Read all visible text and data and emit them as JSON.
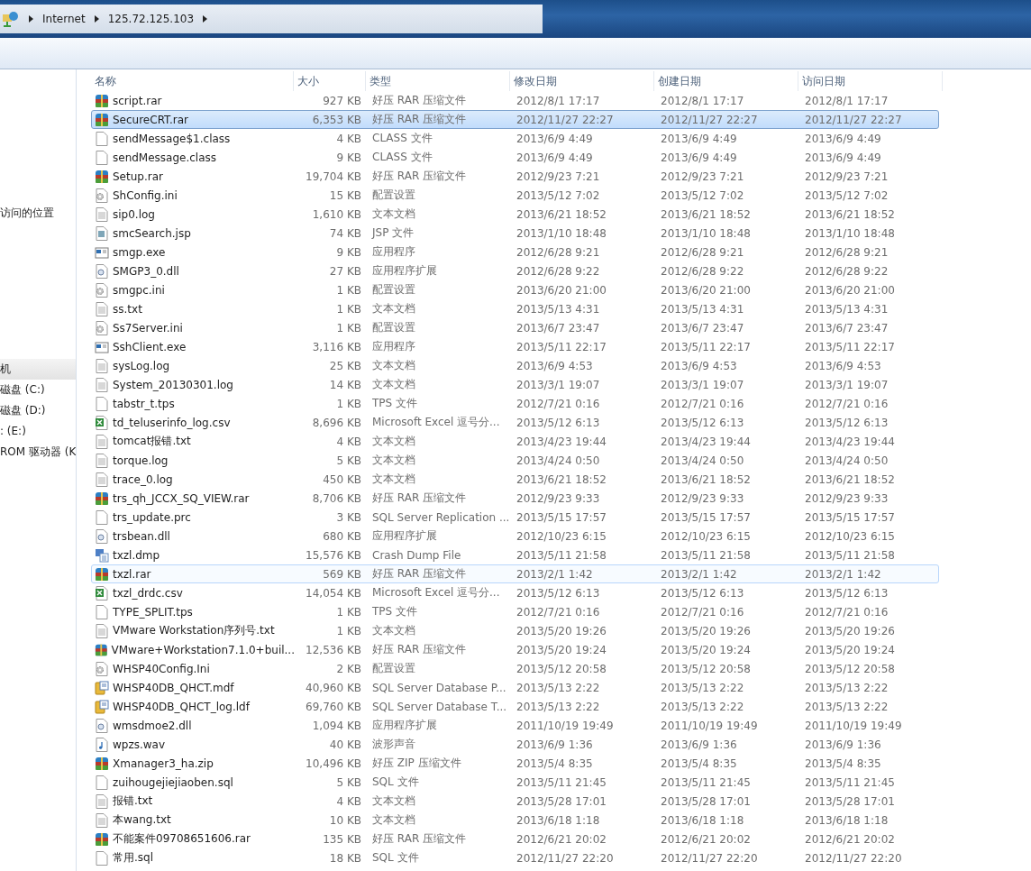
{
  "address_bar": {
    "crumbs": [
      "Internet",
      "125.72.125.103"
    ]
  },
  "sidebar": {
    "items": [
      {
        "label": "访问的位置",
        "selected": false
      },
      {
        "label": "机",
        "selected": true
      },
      {
        "label": "磁盘 (C:)",
        "selected": false
      },
      {
        "label": "磁盘 (D:)",
        "selected": false
      },
      {
        "label": ": (E:)",
        "selected": false
      },
      {
        "label": "ROM 驱动器 (K",
        "selected": false
      }
    ]
  },
  "table": {
    "columns": [
      "名称",
      "大小",
      "类型",
      "修改日期",
      "创建日期",
      "访问日期"
    ],
    "rows": [
      {
        "kind": "rar",
        "name": "script.rar",
        "size": "927 KB",
        "type": "好压 RAR 压缩文件",
        "modified": "2012/8/1 17:17",
        "created": "2012/8/1 17:17",
        "accessed": "2012/8/1 17:17",
        "selected": false,
        "focused": false
      },
      {
        "kind": "rar",
        "name": "SecureCRT.rar",
        "size": "6,353 KB",
        "type": "好压 RAR 压缩文件",
        "modified": "2012/11/27 22:27",
        "created": "2012/11/27 22:27",
        "accessed": "2012/11/27 22:27",
        "selected": true,
        "focused": false
      },
      {
        "kind": "blank",
        "name": "sendMessage$1.class",
        "size": "4 KB",
        "type": "CLASS 文件",
        "modified": "2013/6/9 4:49",
        "created": "2013/6/9 4:49",
        "accessed": "2013/6/9 4:49",
        "selected": false,
        "focused": false
      },
      {
        "kind": "blank",
        "name": "sendMessage.class",
        "size": "9 KB",
        "type": "CLASS 文件",
        "modified": "2013/6/9 4:49",
        "created": "2013/6/9 4:49",
        "accessed": "2013/6/9 4:49",
        "selected": false,
        "focused": false
      },
      {
        "kind": "rar",
        "name": "Setup.rar",
        "size": "19,704 KB",
        "type": "好压 RAR 压缩文件",
        "modified": "2012/9/23 7:21",
        "created": "2012/9/23 7:21",
        "accessed": "2012/9/23 7:21",
        "selected": false,
        "focused": false
      },
      {
        "kind": "ini",
        "name": "ShConfig.ini",
        "size": "15 KB",
        "type": "配置设置",
        "modified": "2013/5/12 7:02",
        "created": "2013/5/12 7:02",
        "accessed": "2013/5/12 7:02",
        "selected": false,
        "focused": false
      },
      {
        "kind": "text",
        "name": "sip0.log",
        "size": "1,610 KB",
        "type": "文本文档",
        "modified": "2013/6/21 18:52",
        "created": "2013/6/21 18:52",
        "accessed": "2013/6/21 18:52",
        "selected": false,
        "focused": false
      },
      {
        "kind": "script",
        "name": "smcSearch.jsp",
        "size": "74 KB",
        "type": "JSP 文件",
        "modified": "2013/1/10 18:48",
        "created": "2013/1/10 18:48",
        "accessed": "2013/1/10 18:48",
        "selected": false,
        "focused": false
      },
      {
        "kind": "exe",
        "name": "smgp.exe",
        "size": "9 KB",
        "type": "应用程序",
        "modified": "2012/6/28 9:21",
        "created": "2012/6/28 9:21",
        "accessed": "2012/6/28 9:21",
        "selected": false,
        "focused": false
      },
      {
        "kind": "dll",
        "name": "SMGP3_0.dll",
        "size": "27 KB",
        "type": "应用程序扩展",
        "modified": "2012/6/28 9:22",
        "created": "2012/6/28 9:22",
        "accessed": "2012/6/28 9:22",
        "selected": false,
        "focused": false
      },
      {
        "kind": "ini",
        "name": "smgpc.ini",
        "size": "1 KB",
        "type": "配置设置",
        "modified": "2013/6/20 21:00",
        "created": "2013/6/20 21:00",
        "accessed": "2013/6/20 21:00",
        "selected": false,
        "focused": false
      },
      {
        "kind": "text",
        "name": "ss.txt",
        "size": "1 KB",
        "type": "文本文档",
        "modified": "2013/5/13 4:31",
        "created": "2013/5/13 4:31",
        "accessed": "2013/5/13 4:31",
        "selected": false,
        "focused": false
      },
      {
        "kind": "ini",
        "name": "Ss7Server.ini",
        "size": "1 KB",
        "type": "配置设置",
        "modified": "2013/6/7 23:47",
        "created": "2013/6/7 23:47",
        "accessed": "2013/6/7 23:47",
        "selected": false,
        "focused": false
      },
      {
        "kind": "exe",
        "name": "SshClient.exe",
        "size": "3,116 KB",
        "type": "应用程序",
        "modified": "2013/5/11 22:17",
        "created": "2013/5/11 22:17",
        "accessed": "2013/5/11 22:17",
        "selected": false,
        "focused": false
      },
      {
        "kind": "text",
        "name": "sysLog.log",
        "size": "25 KB",
        "type": "文本文档",
        "modified": "2013/6/9 4:53",
        "created": "2013/6/9 4:53",
        "accessed": "2013/6/9 4:53",
        "selected": false,
        "focused": false
      },
      {
        "kind": "text",
        "name": "System_20130301.log",
        "size": "14 KB",
        "type": "文本文档",
        "modified": "2013/3/1 19:07",
        "created": "2013/3/1 19:07",
        "accessed": "2013/3/1 19:07",
        "selected": false,
        "focused": false
      },
      {
        "kind": "blank",
        "name": "tabstr_t.tps",
        "size": "1 KB",
        "type": "TPS 文件",
        "modified": "2012/7/21 0:16",
        "created": "2012/7/21 0:16",
        "accessed": "2012/7/21 0:16",
        "selected": false,
        "focused": false
      },
      {
        "kind": "excel",
        "name": "td_teluserinfo_log.csv",
        "size": "8,696 KB",
        "type": "Microsoft Excel 逗号分...",
        "modified": "2013/5/12 6:13",
        "created": "2013/5/12 6:13",
        "accessed": "2013/5/12 6:13",
        "selected": false,
        "focused": false
      },
      {
        "kind": "text",
        "name": "tomcat报错.txt",
        "size": "4 KB",
        "type": "文本文档",
        "modified": "2013/4/23 19:44",
        "created": "2013/4/23 19:44",
        "accessed": "2013/4/23 19:44",
        "selected": false,
        "focused": false
      },
      {
        "kind": "text",
        "name": "torque.log",
        "size": "5 KB",
        "type": "文本文档",
        "modified": "2013/4/24 0:50",
        "created": "2013/4/24 0:50",
        "accessed": "2013/4/24 0:50",
        "selected": false,
        "focused": false
      },
      {
        "kind": "text",
        "name": "trace_0.log",
        "size": "450 KB",
        "type": "文本文档",
        "modified": "2013/6/21 18:52",
        "created": "2013/6/21 18:52",
        "accessed": "2013/6/21 18:52",
        "selected": false,
        "focused": false
      },
      {
        "kind": "rar",
        "name": "trs_qh_JCCX_SQ_VIEW.rar",
        "size": "8,706 KB",
        "type": "好压 RAR 压缩文件",
        "modified": "2012/9/23 9:33",
        "created": "2012/9/23 9:33",
        "accessed": "2012/9/23 9:33",
        "selected": false,
        "focused": false
      },
      {
        "kind": "blank",
        "name": "trs_update.prc",
        "size": "3 KB",
        "type": "SQL Server Replication ...",
        "modified": "2013/5/15 17:57",
        "created": "2013/5/15 17:57",
        "accessed": "2013/5/15 17:57",
        "selected": false,
        "focused": false
      },
      {
        "kind": "dll",
        "name": "trsbean.dll",
        "size": "680 KB",
        "type": "应用程序扩展",
        "modified": "2012/10/23 6:15",
        "created": "2012/10/23 6:15",
        "accessed": "2012/10/23 6:15",
        "selected": false,
        "focused": false
      },
      {
        "kind": "dump",
        "name": "txzl.dmp",
        "size": "15,576 KB",
        "type": "Crash Dump File",
        "modified": "2013/5/11 21:58",
        "created": "2013/5/11 21:58",
        "accessed": "2013/5/11 21:58",
        "selected": false,
        "focused": false
      },
      {
        "kind": "rar",
        "name": "txzl.rar",
        "size": "569 KB",
        "type": "好压 RAR 压缩文件",
        "modified": "2013/2/1 1:42",
        "created": "2013/2/1 1:42",
        "accessed": "2013/2/1 1:42",
        "selected": false,
        "focused": true
      },
      {
        "kind": "excel",
        "name": "txzl_drdc.csv",
        "size": "14,054 KB",
        "type": "Microsoft Excel 逗号分...",
        "modified": "2013/5/12 6:13",
        "created": "2013/5/12 6:13",
        "accessed": "2013/5/12 6:13",
        "selected": false,
        "focused": false
      },
      {
        "kind": "blank",
        "name": "TYPE_SPLIT.tps",
        "size": "1 KB",
        "type": "TPS 文件",
        "modified": "2012/7/21 0:16",
        "created": "2012/7/21 0:16",
        "accessed": "2012/7/21 0:16",
        "selected": false,
        "focused": false
      },
      {
        "kind": "text",
        "name": "VMware Workstation序列号.txt",
        "size": "1 KB",
        "type": "文本文档",
        "modified": "2013/5/20 19:26",
        "created": "2013/5/20 19:26",
        "accessed": "2013/5/20 19:26",
        "selected": false,
        "focused": false
      },
      {
        "kind": "rar",
        "name": "VMware+Workstation7.1.0+buil...",
        "size": "12,536 KB",
        "type": "好压 RAR 压缩文件",
        "modified": "2013/5/20 19:24",
        "created": "2013/5/20 19:24",
        "accessed": "2013/5/20 19:24",
        "selected": false,
        "focused": false
      },
      {
        "kind": "ini",
        "name": "WHSP40Config.Ini",
        "size": "2 KB",
        "type": "配置设置",
        "modified": "2013/5/12 20:58",
        "created": "2013/5/12 20:58",
        "accessed": "2013/5/12 20:58",
        "selected": false,
        "focused": false
      },
      {
        "kind": "database",
        "name": "WHSP40DB_QHCT.mdf",
        "size": "40,960 KB",
        "type": "SQL Server Database P...",
        "modified": "2013/5/13 2:22",
        "created": "2013/5/13 2:22",
        "accessed": "2013/5/13 2:22",
        "selected": false,
        "focused": false
      },
      {
        "kind": "database",
        "name": "WHSP40DB_QHCT_log.ldf",
        "size": "69,760 KB",
        "type": "SQL Server Database T...",
        "modified": "2013/5/13 2:22",
        "created": "2013/5/13 2:22",
        "accessed": "2013/5/13 2:22",
        "selected": false,
        "focused": false
      },
      {
        "kind": "dll",
        "name": "wmsdmoe2.dll",
        "size": "1,094 KB",
        "type": "应用程序扩展",
        "modified": "2011/10/19 19:49",
        "created": "2011/10/19 19:49",
        "accessed": "2011/10/19 19:49",
        "selected": false,
        "focused": false
      },
      {
        "kind": "audio",
        "name": "wpzs.wav",
        "size": "40 KB",
        "type": "波形声音",
        "modified": "2013/6/9 1:36",
        "created": "2013/6/9 1:36",
        "accessed": "2013/6/9 1:36",
        "selected": false,
        "focused": false
      },
      {
        "kind": "rar",
        "name": "Xmanager3_ha.zip",
        "size": "10,496 KB",
        "type": "好压 ZIP 压缩文件",
        "modified": "2013/5/4 8:35",
        "created": "2013/5/4 8:35",
        "accessed": "2013/5/4 8:35",
        "selected": false,
        "focused": false
      },
      {
        "kind": "blank",
        "name": "zuihougejiejiaoben.sql",
        "size": "5 KB",
        "type": "SQL 文件",
        "modified": "2013/5/11 21:45",
        "created": "2013/5/11 21:45",
        "accessed": "2013/5/11 21:45",
        "selected": false,
        "focused": false
      },
      {
        "kind": "text",
        "name": "报错.txt",
        "size": "4 KB",
        "type": "文本文档",
        "modified": "2013/5/28 17:01",
        "created": "2013/5/28 17:01",
        "accessed": "2013/5/28 17:01",
        "selected": false,
        "focused": false
      },
      {
        "kind": "text",
        "name": "本wang.txt",
        "size": "10 KB",
        "type": "文本文档",
        "modified": "2013/6/18 1:18",
        "created": "2013/6/18 1:18",
        "accessed": "2013/6/18 1:18",
        "selected": false,
        "focused": false
      },
      {
        "kind": "rar",
        "name": "不能案件09708651606.rar",
        "size": "135 KB",
        "type": "好压 RAR 压缩文件",
        "modified": "2012/6/21 20:02",
        "created": "2012/6/21 20:02",
        "accessed": "2012/6/21 20:02",
        "selected": false,
        "focused": false
      },
      {
        "kind": "blank",
        "name": "常用.sql",
        "size": "18 KB",
        "type": "SQL 文件",
        "modified": "2012/11/27 22:20",
        "created": "2012/11/27 22:20",
        "accessed": "2012/11/27 22:20",
        "selected": false,
        "focused": false
      }
    ]
  }
}
